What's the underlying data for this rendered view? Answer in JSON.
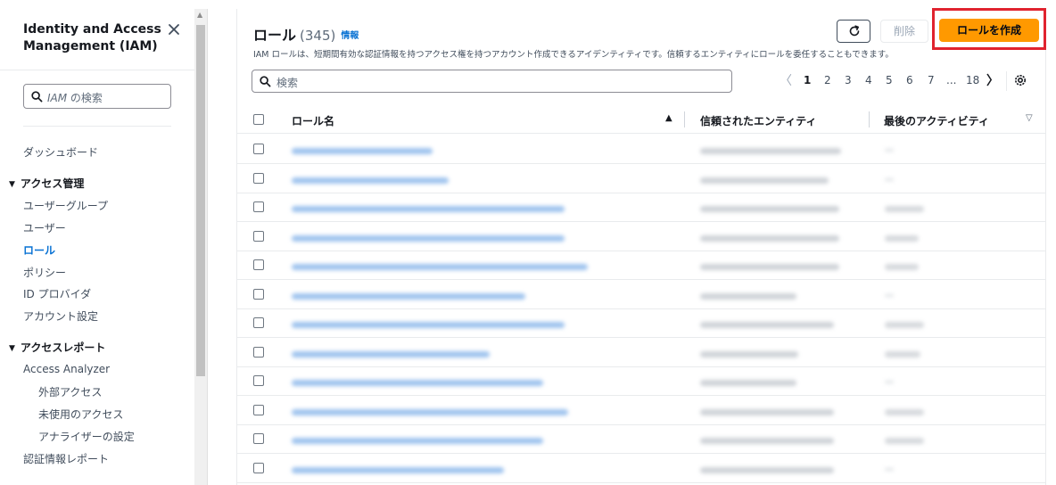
{
  "sidebar": {
    "title": "Identity and Access Management (IAM)",
    "search_prefix": "IAM",
    "search_suffix": " の検索",
    "dashboard": "ダッシュボード",
    "access_management": {
      "label": "アクセス管理",
      "items": [
        "ユーザーグループ",
        "ユーザー",
        "ロール",
        "ポリシー",
        "ID プロバイダ",
        "アカウント設定"
      ]
    },
    "access_reports": {
      "label": "アクセスレポート",
      "items": [
        "Access Analyzer",
        "外部アクセス",
        "未使用のアクセス",
        "アナライザーの設定",
        "認証情報レポート"
      ]
    }
  },
  "header": {
    "title": "ロール",
    "count": "(345)",
    "info": "情報",
    "description": "IAM ロールは、短期間有効な認証情報を持つアクセス権を持つアカウント作成できるアイデンティティです。信頼するエンティティにロールを委任することもできます。",
    "delete_label": "削除",
    "create_label": "ロールを作成"
  },
  "search": {
    "placeholder": "検索"
  },
  "pagination": {
    "current": "1",
    "pages": [
      "2",
      "3",
      "4",
      "5",
      "6",
      "7"
    ],
    "ellipsis": "...",
    "last": "18"
  },
  "table": {
    "columns": [
      "ロール名",
      "信頼されたエンティティ",
      "最後のアクティビティ"
    ],
    "row_count": 12
  },
  "colors": {
    "accent": "#0972d3",
    "primary_button": "#ff9900",
    "highlight_border": "#e0232f"
  },
  "icons": [
    "close-icon",
    "search-icon",
    "refresh-icon",
    "chevron-left-icon",
    "chevron-right-icon",
    "gear-icon",
    "sort-ascending-icon",
    "sort-descending-icon"
  ]
}
